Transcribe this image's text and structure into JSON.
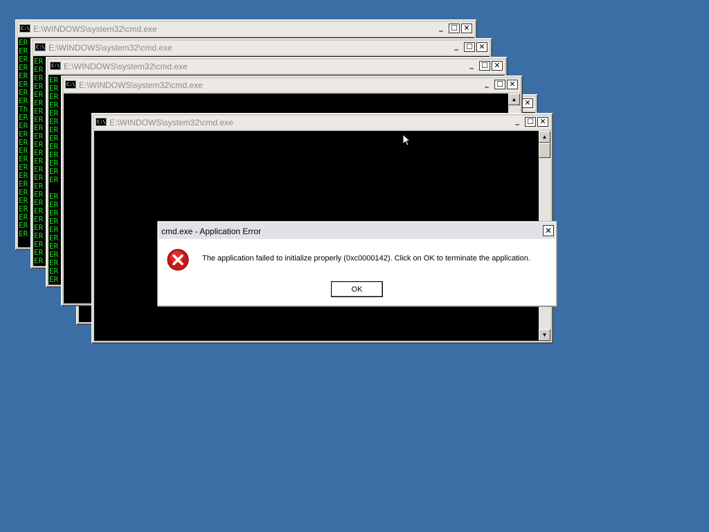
{
  "desktop": {
    "background": "#3a6ea5"
  },
  "windows": [
    {
      "title": "E:\\WINDOWS\\system32\\cmd.exe",
      "lines": [
        "ER",
        "ER",
        "ER",
        "ER",
        "ER",
        "ER",
        "ER",
        "ER",
        "Th",
        "ER",
        "ER",
        "ER",
        "ER",
        "ER",
        "ER",
        "ER",
        "ER",
        "ER",
        "ER",
        "ER",
        "ER",
        "ER",
        "ER",
        "ER"
      ]
    },
    {
      "title": "E:\\WINDOWS\\system32\\cmd.exe",
      "lines": [
        "ER",
        "ER",
        "ER",
        "ER",
        "ER",
        "ER",
        "ER",
        "ER",
        "ER",
        "ER",
        "ER",
        "ER",
        "ER",
        "ER",
        "ER",
        "ER",
        "ER",
        "ER",
        "ER",
        "ER",
        "ER",
        "ER",
        "ER",
        "ER",
        "ER"
      ]
    },
    {
      "title": "E:\\WINDOWS\\system32\\cmd.exe",
      "lines": [
        "ER",
        "ER",
        "ER",
        "ER",
        "ER",
        "ER",
        "ER",
        "ER",
        "ER",
        "ER",
        "ER",
        "ER",
        "ER",
        "",
        "ER",
        "ER",
        "ER",
        "ER",
        "ER",
        "ER",
        "ER",
        "ER",
        "ER",
        "ER",
        "ER"
      ]
    },
    {
      "title": "E:\\WINDOWS\\system32\\cmd.exe",
      "lines": []
    },
    {
      "title": "",
      "lines": [
        "ER"
      ]
    },
    {
      "title": "E:\\WINDOWS\\system32\\cmd.exe",
      "lines": []
    }
  ],
  "dialog": {
    "title": "cmd.exe - Application Error",
    "message": "The application failed to initialize properly (0xc0000142). Click on OK to terminate the application.",
    "ok_label": "OK",
    "icon": "error-icon"
  },
  "icons": {
    "console": "console-icon",
    "minimize": "minimize-icon",
    "maximize": "maximize-icon",
    "close": "close-icon",
    "cursor": "mouse-pointer-icon"
  }
}
